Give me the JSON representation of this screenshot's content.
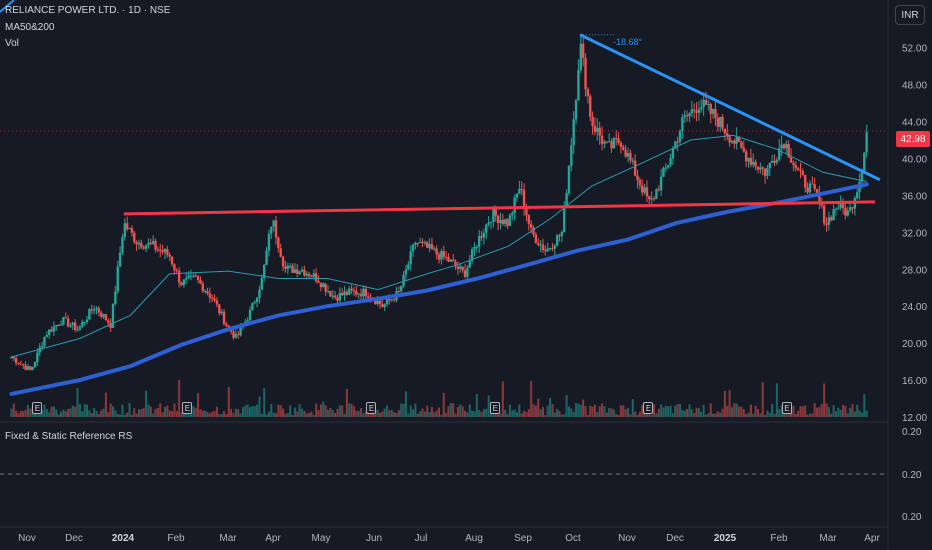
{
  "header": {
    "symbol_line": "RELIANCE POWER LTD. · 1D · NSE",
    "indicator_ma": "MA50&200",
    "indicator_vol": "Vol",
    "currency": "INR"
  },
  "last_price_label": "42.98",
  "angle_label": "-18.68°",
  "earnings_marker": "E",
  "sub_pane": {
    "title": "Fixed & Static Reference RS",
    "ticks": [
      "0.20",
      "0.20",
      "0.20"
    ]
  },
  "colors": {
    "background": "#161a25",
    "up": "#26a69a",
    "down": "#ef5350",
    "ma50": "#2b9ab0",
    "ma200": "#2e5fd3",
    "support_line": "#f23645",
    "trend_line": "#2a93f5"
  },
  "chart_data": {
    "type": "line",
    "title": "RELIANCE POWER LTD. · 1D · NSE",
    "xlabel": "",
    "ylabel": "",
    "ylim": [
      12,
      55
    ],
    "y_ticks": [
      "52.00",
      "48.00",
      "44.00",
      "40.00",
      "36.00",
      "32.00",
      "28.00",
      "24.00",
      "20.00",
      "16.00",
      "12.00"
    ],
    "x_ticks": [
      {
        "label": "Nov",
        "bold": false
      },
      {
        "label": "Dec",
        "bold": false
      },
      {
        "label": "2024",
        "bold": true
      },
      {
        "label": "Feb",
        "bold": false
      },
      {
        "label": "Mar",
        "bold": false
      },
      {
        "label": "Apr",
        "bold": false
      },
      {
        "label": "May",
        "bold": false
      },
      {
        "label": "Jun",
        "bold": false
      },
      {
        "label": "Jul",
        "bold": false
      },
      {
        "label": "Aug",
        "bold": false
      },
      {
        "label": "Sep",
        "bold": false
      },
      {
        "label": "Oct",
        "bold": false
      },
      {
        "label": "Nov",
        "bold": false
      },
      {
        "label": "Dec",
        "bold": false
      },
      {
        "label": "2025",
        "bold": true
      },
      {
        "label": "Feb",
        "bold": false
      },
      {
        "label": "Mar",
        "bold": false
      },
      {
        "label": "Apr",
        "bold": false
      }
    ],
    "price_series": [
      [
        "2023-10-20",
        18.5
      ],
      [
        "2023-11-01",
        17.0
      ],
      [
        "2023-11-10",
        21.0
      ],
      [
        "2023-11-20",
        22.5
      ],
      [
        "2023-11-30",
        21.5
      ],
      [
        "2023-12-10",
        24.0
      ],
      [
        "2023-12-20",
        22.0
      ],
      [
        "2023-12-28",
        33.0
      ],
      [
        "2024-01-05",
        31.0
      ],
      [
        "2024-01-15",
        30.5
      ],
      [
        "2024-01-25",
        29.5
      ],
      [
        "2024-02-01",
        26.5
      ],
      [
        "2024-02-10",
        27.0
      ],
      [
        "2024-02-20",
        25.0
      ],
      [
        "2024-02-29",
        22.0
      ],
      [
        "2024-03-06",
        20.5
      ],
      [
        "2024-03-15",
        23.5
      ],
      [
        "2024-03-22",
        27.0
      ],
      [
        "2024-03-28",
        33.5
      ],
      [
        "2024-04-05",
        28.0
      ],
      [
        "2024-04-15",
        28.0
      ],
      [
        "2024-04-25",
        27.0
      ],
      [
        "2024-05-05",
        25.0
      ],
      [
        "2024-05-15",
        25.5
      ],
      [
        "2024-05-25",
        25.5
      ],
      [
        "2024-06-04",
        24.0
      ],
      [
        "2024-06-14",
        25.5
      ],
      [
        "2024-06-24",
        31.0
      ],
      [
        "2024-07-04",
        30.0
      ],
      [
        "2024-07-14",
        29.0
      ],
      [
        "2024-07-24",
        27.5
      ],
      [
        "2024-08-01",
        31.0
      ],
      [
        "2024-08-10",
        34.0
      ],
      [
        "2024-08-20",
        33.0
      ],
      [
        "2024-08-27",
        37.0
      ],
      [
        "2024-09-03",
        32.0
      ],
      [
        "2024-09-12",
        30.0
      ],
      [
        "2024-09-22",
        32.0
      ],
      [
        "2024-09-30",
        46.0
      ],
      [
        "2024-10-03",
        52.5
      ],
      [
        "2024-10-10",
        44.0
      ],
      [
        "2024-10-20",
        41.0
      ],
      [
        "2024-10-28",
        42.0
      ],
      [
        "2024-11-07",
        38.0
      ],
      [
        "2024-11-15",
        35.0
      ],
      [
        "2024-11-25",
        39.0
      ],
      [
        "2024-12-05",
        44.0
      ],
      [
        "2024-12-15",
        46.0
      ],
      [
        "2024-12-25",
        44.5
      ],
      [
        "2025-01-05",
        42.0
      ],
      [
        "2025-01-15",
        40.0
      ],
      [
        "2025-01-25",
        38.5
      ],
      [
        "2025-02-05",
        42.0
      ],
      [
        "2025-02-15",
        38.0
      ],
      [
        "2025-02-25",
        36.0
      ],
      [
        "2025-03-03",
        33.0
      ],
      [
        "2025-03-10",
        35.0
      ],
      [
        "2025-03-17",
        34.0
      ],
      [
        "2025-03-24",
        38.0
      ],
      [
        "2025-03-28",
        42.98
      ]
    ],
    "ma50_series": [
      [
        "2023-10-20",
        18.5
      ],
      [
        "2023-12-01",
        20.5
      ],
      [
        "2024-01-01",
        23.0
      ],
      [
        "2024-01-25",
        27.5
      ],
      [
        "2024-03-01",
        27.8
      ],
      [
        "2024-04-01",
        27.0
      ],
      [
        "2024-05-01",
        27.0
      ],
      [
        "2024-06-01",
        25.8
      ],
      [
        "2024-07-01",
        27.5
      ],
      [
        "2024-07-20",
        28.5
      ],
      [
        "2024-08-20",
        30.5
      ],
      [
        "2024-09-15",
        33.5
      ],
      [
        "2024-10-10",
        37.0
      ],
      [
        "2024-11-10",
        39.5
      ],
      [
        "2024-12-10",
        42.0
      ],
      [
        "2025-01-05",
        42.5
      ],
      [
        "2025-02-01",
        41.0
      ],
      [
        "2025-03-01",
        38.5
      ],
      [
        "2025-03-28",
        37.5
      ]
    ],
    "ma200_series": [
      [
        "2023-10-20",
        14.5
      ],
      [
        "2023-12-01",
        16.0
      ],
      [
        "2024-01-01",
        17.5
      ],
      [
        "2024-02-01",
        19.8
      ],
      [
        "2024-03-01",
        21.5
      ],
      [
        "2024-04-01",
        23.0
      ],
      [
        "2024-05-01",
        24.0
      ],
      [
        "2024-06-01",
        24.8
      ],
      [
        "2024-07-01",
        25.7
      ],
      [
        "2024-08-01",
        27.0
      ],
      [
        "2024-09-01",
        28.5
      ],
      [
        "2024-10-01",
        30.0
      ],
      [
        "2024-11-01",
        31.2
      ],
      [
        "2024-12-01",
        33.0
      ],
      [
        "2025-01-01",
        34.2
      ],
      [
        "2025-02-01",
        35.2
      ],
      [
        "2025-03-01",
        36.2
      ],
      [
        "2025-03-28",
        37.2
      ]
    ],
    "support_line": [
      [
        "2023-12-28",
        34.0
      ],
      [
        "2025-04-02",
        35.3
      ]
    ],
    "trend_line": [
      [
        "2024-10-03",
        53.4
      ],
      [
        "2025-04-05",
        37.7
      ]
    ],
    "earnings_dates": [
      "2023-11-05",
      "2024-02-05",
      "2024-05-28",
      "2024-08-12",
      "2024-11-14",
      "2025-02-07"
    ],
    "legend": [
      "MA50&200",
      "Vol"
    ]
  }
}
